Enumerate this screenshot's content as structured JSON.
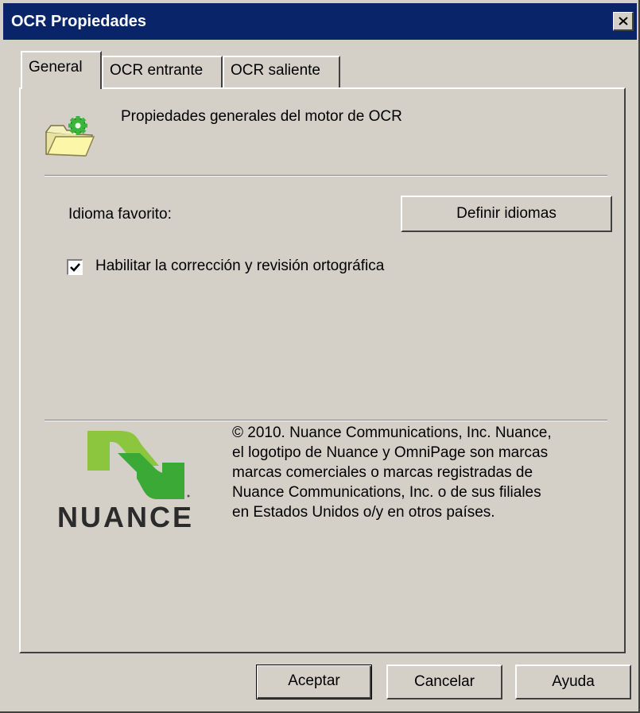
{
  "window": {
    "title": "OCR Propiedades"
  },
  "tabs": [
    {
      "label": "General",
      "active": true
    },
    {
      "label": "OCR entrante",
      "active": false
    },
    {
      "label": "OCR saliente",
      "active": false
    }
  ],
  "general": {
    "header": "Propiedades generales del motor de OCR",
    "favorite_language_label": "Idioma favorito:",
    "define_languages_button": "Definir idiomas",
    "spellcheck_label": "Habilitar la corrección y revisión ortográfica",
    "spellcheck_checked": true,
    "logo_text": "NUANCE",
    "copyright_lines": [
      "© 2010. Nuance Communications, Inc. Nuance,",
      "el logotipo de Nuance y OmniPage son marcas",
      "marcas comerciales o marcas registradas de",
      "Nuance Communications, Inc. o de sus filiales",
      "en Estados Unidos o/y en otros países."
    ]
  },
  "buttons": {
    "ok": "Aceptar",
    "cancel": "Cancelar",
    "help": "Ayuda"
  },
  "icons": {
    "close": "close-icon",
    "header": "folder-gear-icon",
    "checkbox": "checkmark-icon",
    "logo": "nuance-logo"
  },
  "colors": {
    "titlebar": "#0a246a",
    "face": "#d4d0c8",
    "logo_green_light": "#8cc63f",
    "logo_green_dark": "#3aa935"
  }
}
